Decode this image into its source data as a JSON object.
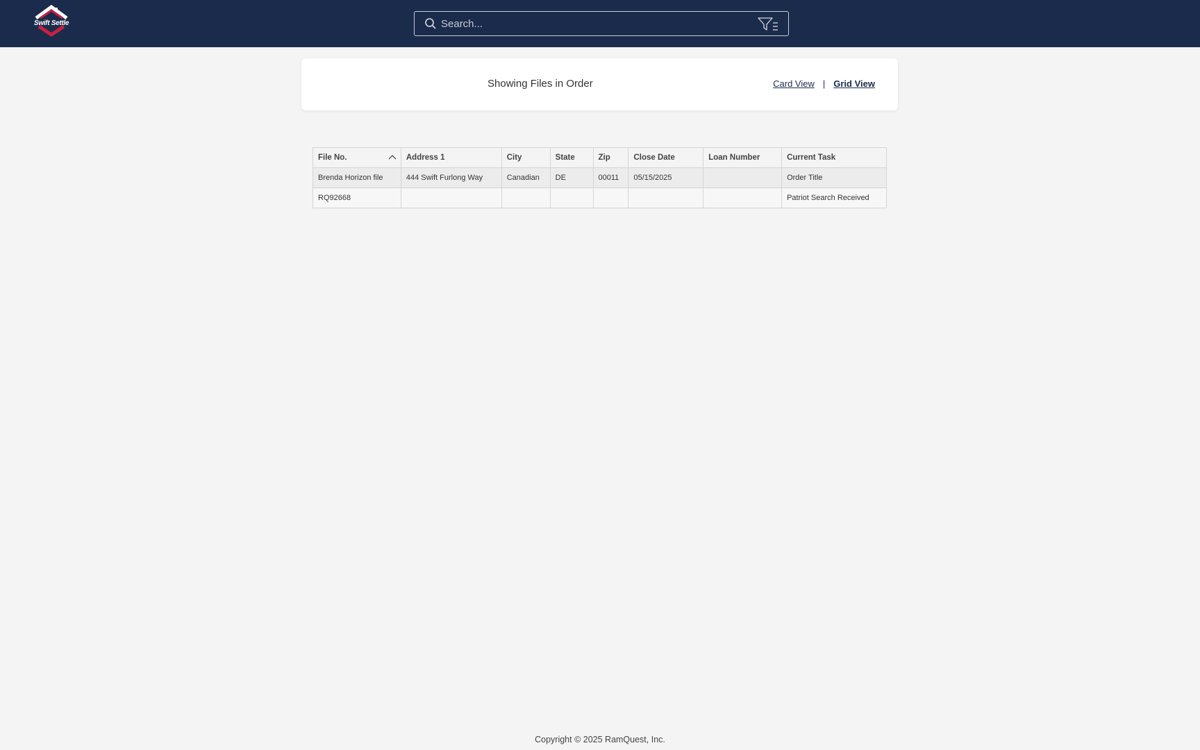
{
  "app": {
    "logo_text": "Swift Settle",
    "colors": {
      "topbar": "#1b2b4b",
      "logo_accent": "#c8203f",
      "background": "#f4f4f4"
    }
  },
  "search": {
    "placeholder": "Search...",
    "value": "",
    "icon": "search-icon",
    "filter_icon": "filter-icon"
  },
  "header": {
    "title": "Showing Files in Order",
    "card_view_label": "Card View",
    "separator": "|",
    "grid_view_label": "Grid View",
    "active_view": "Grid View"
  },
  "table": {
    "columns": [
      "File No.",
      "Address 1",
      "City",
      "State",
      "Zip",
      "Close Date",
      "Loan Number",
      "Current Task"
    ],
    "sort": {
      "column": "File No.",
      "direction": "ascending"
    },
    "rows": [
      [
        "Brenda Horizon file",
        "444 Swift Furlong Way",
        "Canadian",
        "DE",
        "00011",
        "05/15/2025",
        "",
        "Order Title"
      ],
      [
        "RQ92668",
        "",
        "",
        "",
        "",
        "",
        "",
        "Patriot Search Received"
      ]
    ]
  },
  "footer": {
    "copyright": "Copyright © 2025 RamQuest, Inc."
  }
}
